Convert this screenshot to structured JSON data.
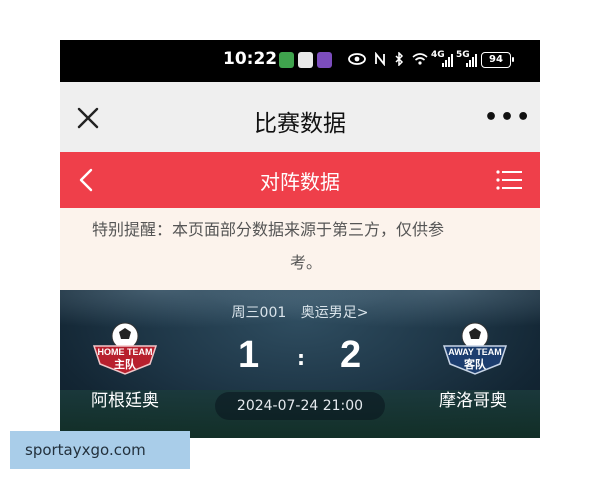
{
  "status_bar": {
    "time": "10:22",
    "network_1": "4G",
    "network_2": "5G",
    "battery": "94"
  },
  "title_bar": {
    "title": "比赛数据"
  },
  "section_header": {
    "title": "对阵数据"
  },
  "notice": {
    "line1": "特别提醒：本页面部分数据来源于第三方，仅供参",
    "line2": "考。"
  },
  "match": {
    "code": "周三001",
    "league": "奥运男足>",
    "home_team": "阿根廷奥",
    "away_team": "摩洛哥奥",
    "home_score": "1",
    "separator": ":",
    "away_score": "2",
    "datetime": "2024-07-24 21:00",
    "home_badge": {
      "line1": "HOME TEAM",
      "line2": "主队"
    },
    "away_badge": {
      "line1": "AWAY TEAM",
      "line2": "客队"
    }
  },
  "watermark": "sportayxgo.com",
  "colors": {
    "status_bar": "#000000",
    "title_bar": "#efefef",
    "header_red": "#ef3f4a",
    "notice_bg": "#fcf3ec",
    "match_bg": "#1a3344",
    "badge_red": "#b8202e",
    "watermark_bg": "#a9cde9"
  },
  "icons": {
    "close": "close-icon",
    "more": "more-icon",
    "back": "chevron-left-icon",
    "menu": "list-icon"
  }
}
